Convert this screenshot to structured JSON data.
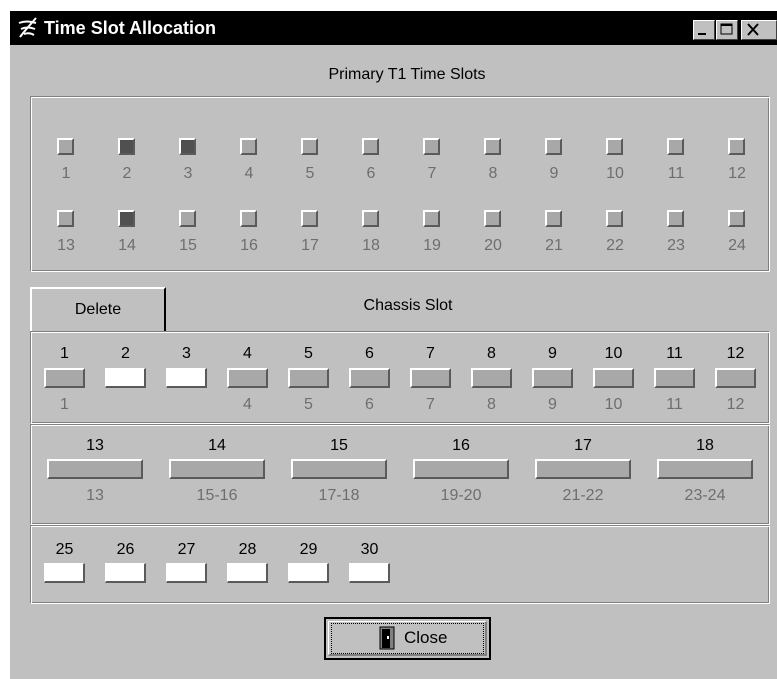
{
  "window": {
    "title": "Time Slot Allocation"
  },
  "titlebar_buttons": [
    "minimize-button",
    "maximize-button",
    "close-window-button"
  ],
  "primary": {
    "heading": "Primary T1 Time Slots",
    "row1": [
      {
        "label": "1",
        "active": false
      },
      {
        "label": "2",
        "active": true
      },
      {
        "label": "3",
        "active": true
      },
      {
        "label": "4",
        "active": false
      },
      {
        "label": "5",
        "active": false
      },
      {
        "label": "6",
        "active": false
      },
      {
        "label": "7",
        "active": false
      },
      {
        "label": "8",
        "active": false
      },
      {
        "label": "9",
        "active": false
      },
      {
        "label": "10",
        "active": false
      },
      {
        "label": "11",
        "active": false
      },
      {
        "label": "12",
        "active": false
      }
    ],
    "row2": [
      {
        "label": "13",
        "active": false
      },
      {
        "label": "14",
        "active": true
      },
      {
        "label": "15",
        "active": false
      },
      {
        "label": "16",
        "active": false
      },
      {
        "label": "17",
        "active": false
      },
      {
        "label": "18",
        "active": false
      },
      {
        "label": "19",
        "active": false
      },
      {
        "label": "20",
        "active": false
      },
      {
        "label": "21",
        "active": false
      },
      {
        "label": "22",
        "active": false
      },
      {
        "label": "23",
        "active": false
      },
      {
        "label": "24",
        "active": false
      }
    ]
  },
  "delete_label": "Delete",
  "chassis": {
    "heading": "Chassis Slot",
    "row1": [
      {
        "num": "1",
        "sub": "1",
        "filled": true
      },
      {
        "num": "2",
        "sub": "",
        "filled": false
      },
      {
        "num": "3",
        "sub": "",
        "filled": false
      },
      {
        "num": "4",
        "sub": "4",
        "filled": true
      },
      {
        "num": "5",
        "sub": "5",
        "filled": true
      },
      {
        "num": "6",
        "sub": "6",
        "filled": true
      },
      {
        "num": "7",
        "sub": "7",
        "filled": true
      },
      {
        "num": "8",
        "sub": "8",
        "filled": true
      },
      {
        "num": "9",
        "sub": "9",
        "filled": true
      },
      {
        "num": "10",
        "sub": "10",
        "filled": true
      },
      {
        "num": "11",
        "sub": "11",
        "filled": true
      },
      {
        "num": "12",
        "sub": "12",
        "filled": true
      }
    ],
    "row2": [
      {
        "num": "13",
        "sub": "13",
        "filled": true
      },
      {
        "num": "14",
        "sub": "15-16",
        "filled": true
      },
      {
        "num": "15",
        "sub": "17-18",
        "filled": true
      },
      {
        "num": "16",
        "sub": "19-20",
        "filled": true
      },
      {
        "num": "17",
        "sub": "21-22",
        "filled": true
      },
      {
        "num": "18",
        "sub": "23-24",
        "filled": true
      }
    ],
    "row3": [
      {
        "num": "25",
        "sub": "",
        "filled": false
      },
      {
        "num": "26",
        "sub": "",
        "filled": false
      },
      {
        "num": "27",
        "sub": "",
        "filled": false
      },
      {
        "num": "28",
        "sub": "",
        "filled": false
      },
      {
        "num": "29",
        "sub": "",
        "filled": false
      },
      {
        "num": "30",
        "sub": "",
        "filled": false
      }
    ]
  },
  "close_label": "Close",
  "colors": {
    "titlebar": "#000000",
    "face": "#c0c0c0",
    "lamp_off": "#a8a8a8",
    "lamp_on": "#505050",
    "sub_text": "#6e6e6e"
  }
}
